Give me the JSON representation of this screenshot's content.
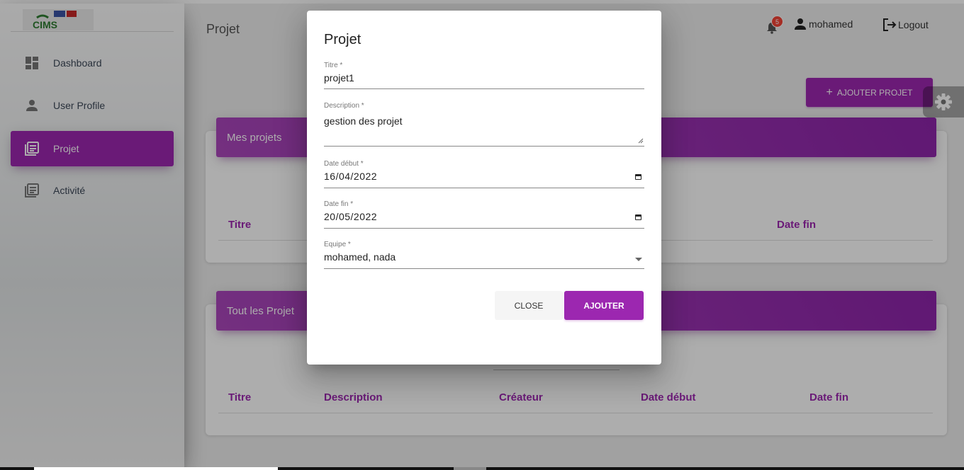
{
  "app": {
    "logo_text": "CIMS",
    "page_title": "Projet"
  },
  "sidebar": {
    "items": [
      {
        "label": "Dashboard",
        "icon": "dashboard-icon"
      },
      {
        "label": "User Profile",
        "icon": "person-icon"
      },
      {
        "label": "Projet",
        "icon": "library-books-icon",
        "active": true
      },
      {
        "label": "Activité",
        "icon": "library-books-icon"
      }
    ]
  },
  "header": {
    "notifications_count": "5",
    "username": "mohamed",
    "logout_label": "Logout"
  },
  "main": {
    "add_button_label": "AJOUTER PROJET",
    "mes_projets": {
      "title": "Mes projets",
      "columns": [
        "Titre",
        "Date fin"
      ]
    },
    "tout_projets": {
      "title": "Tout les Projet",
      "columns": [
        "Titre",
        "Description",
        "Créateur",
        "Date début",
        "Date fin"
      ]
    }
  },
  "dialog": {
    "title": "Projet",
    "fields": {
      "titre": {
        "label": "Titre *",
        "value": "projet1"
      },
      "description": {
        "label": "Description *",
        "value": "gestion des projet"
      },
      "date_debut": {
        "label": "Date début *",
        "value": "16/04/2022"
      },
      "date_fin": {
        "label": "Date fin *",
        "value": "20/05/2022"
      },
      "equipe": {
        "label": "Equipe *",
        "value": "mohamed, nada"
      }
    },
    "close_label": "CLOSE",
    "submit_label": "AJOUTER"
  },
  "colors": {
    "accent": "#9c27b0",
    "badge": "#f44336"
  }
}
